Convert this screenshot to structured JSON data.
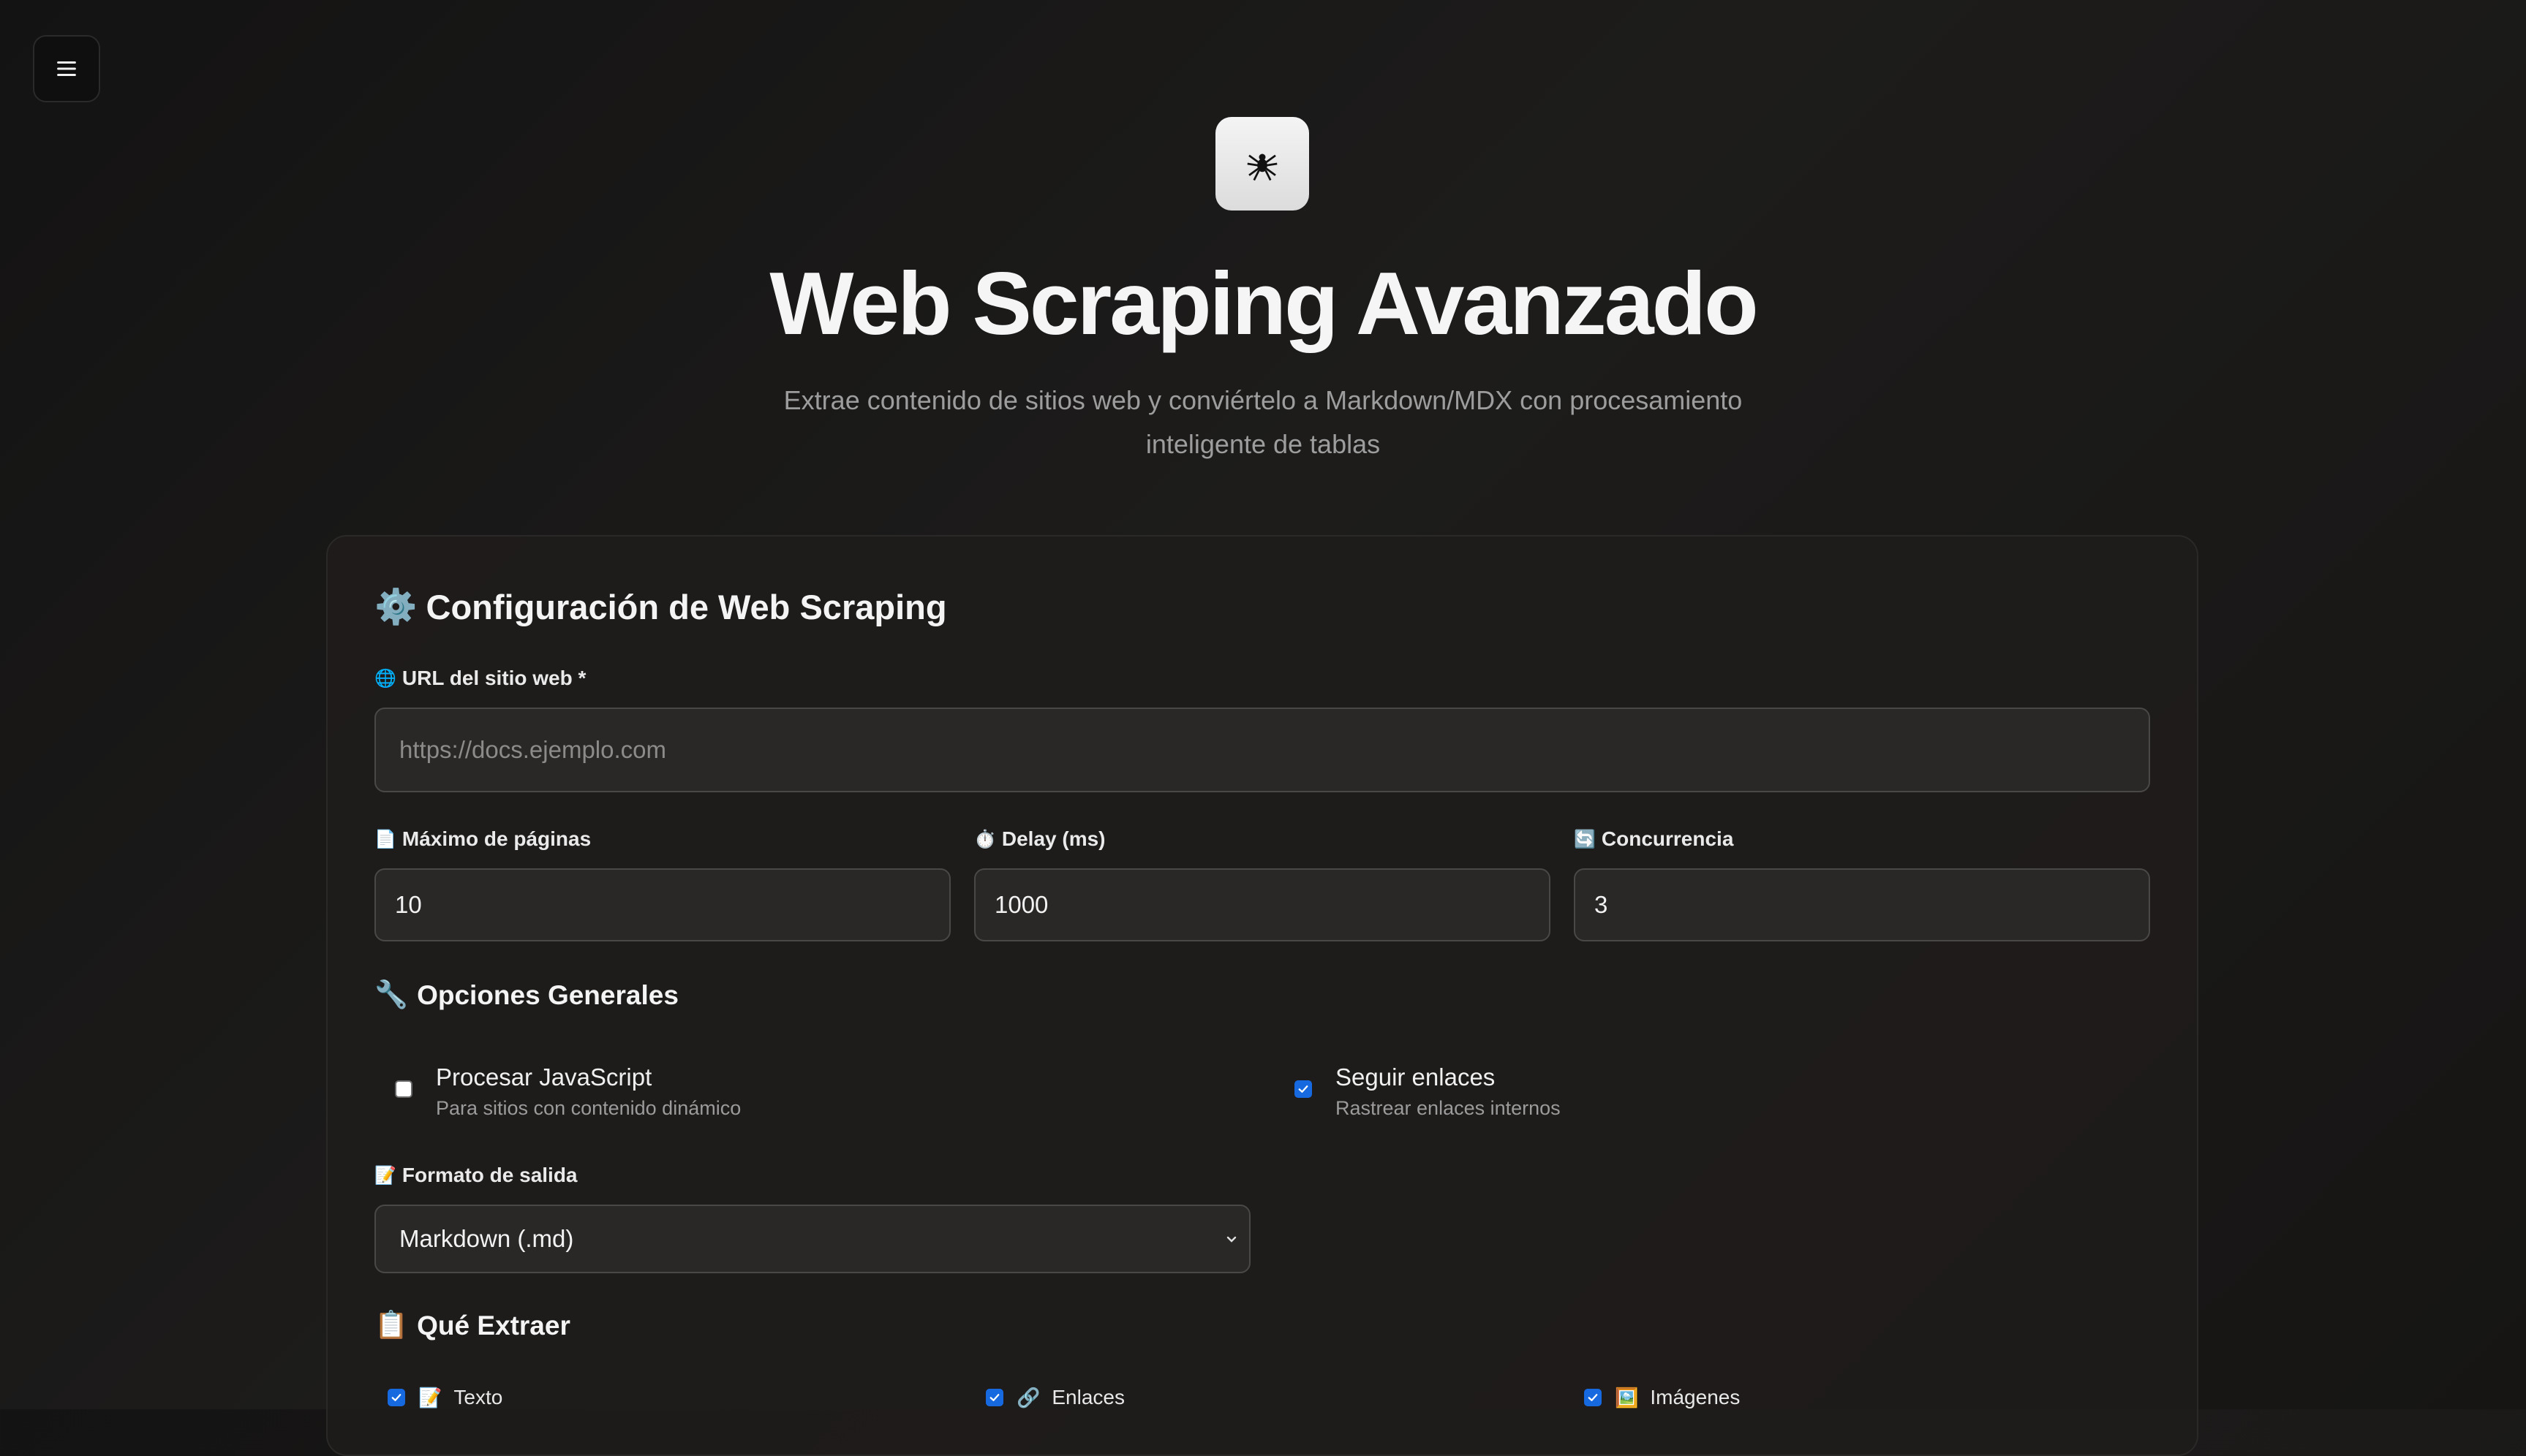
{
  "header": {
    "title": "Web Scraping Avanzado",
    "subtitle_line1": "Extrae contenido de sitios web y conviértelo a Markdown/MDX con procesamiento",
    "subtitle_line2": "inteligente de tablas",
    "logo_icon": "spider-icon"
  },
  "config": {
    "title": "Configuración de Web Scraping",
    "title_icon": "⚙️",
    "url": {
      "icon": "🌐",
      "label": "URL del sitio web *",
      "placeholder": "https://docs.ejemplo.com",
      "value": ""
    },
    "max_pages": {
      "icon": "📄",
      "label": "Máximo de páginas",
      "value": "10"
    },
    "delay": {
      "icon": "⏱️",
      "label": "Delay (ms)",
      "value": "1000"
    },
    "concurrency": {
      "icon": "🔄",
      "label": "Concurrencia",
      "value": "3"
    }
  },
  "general_options": {
    "title": "Opciones Generales",
    "icon": "🔧",
    "options": [
      {
        "label": "Procesar JavaScript",
        "description": "Para sitios con contenido dinámico",
        "checked": false
      },
      {
        "label": "Seguir enlaces",
        "description": "Rastrear enlaces internos",
        "checked": true
      }
    ]
  },
  "output_format": {
    "icon": "📝",
    "label": "Formato de salida",
    "selected": "Markdown (.md)"
  },
  "extract": {
    "title": "Qué Extraer",
    "icon": "📋",
    "items": [
      {
        "icon": "📝",
        "label": "Texto",
        "checked": true
      },
      {
        "icon": "🔗",
        "label": "Enlaces",
        "checked": true
      },
      {
        "icon": "🖼️",
        "label": "Imágenes",
        "checked": true
      }
    ]
  },
  "colors": {
    "accent": "#1769e0",
    "background": "#1a1918",
    "card": "#1e1c1b"
  }
}
